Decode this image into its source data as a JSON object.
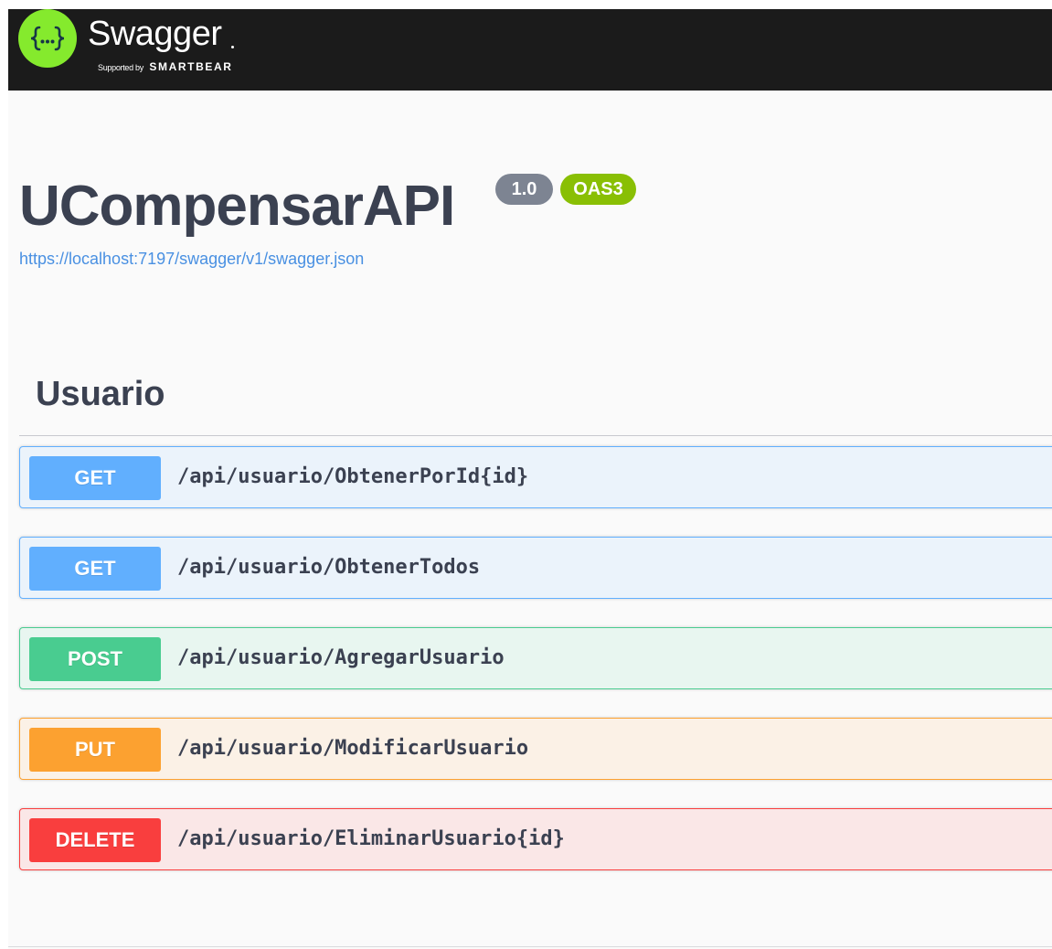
{
  "topbar": {
    "brand_name": "Swagger",
    "supported_by": "Supported by",
    "company": "SMARTBEAR",
    "logo_glyph": "{···}",
    "icon": "swagger-braces-icon"
  },
  "info": {
    "title": "UCompensarAPI",
    "version": "1.0",
    "oas_badge": "OAS3",
    "spec_url": "https://localhost:7197/swagger/v1/swagger.json"
  },
  "tag": {
    "name": "Usuario",
    "operations": [
      {
        "method": "GET",
        "path": "/api/usuario/ObtenerPorId{id}",
        "color": "#61affe"
      },
      {
        "method": "GET",
        "path": "/api/usuario/ObtenerTodos",
        "color": "#61affe"
      },
      {
        "method": "POST",
        "path": "/api/usuario/AgregarUsuario",
        "color": "#49cc90"
      },
      {
        "method": "PUT",
        "path": "/api/usuario/ModificarUsuario",
        "color": "#fca130"
      },
      {
        "method": "DELETE",
        "path": "/api/usuario/EliminarUsuario{id}",
        "color": "#f93e3e"
      }
    ]
  },
  "colors": {
    "topbar_bg": "#1b1b1b",
    "logo_green": "#85ea2d",
    "title_text": "#3b4151",
    "link": "#4990e2",
    "version_badge": "#7d8492",
    "oas_badge": "#89bf04"
  }
}
